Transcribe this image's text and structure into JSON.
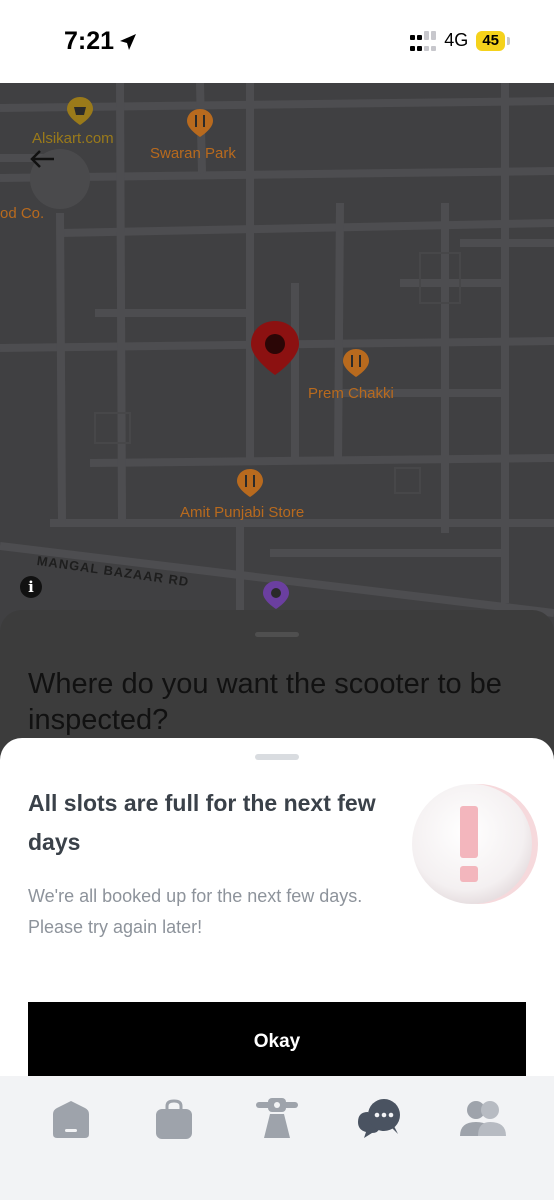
{
  "status_bar": {
    "time": "7:21",
    "network": "4G",
    "battery": "45"
  },
  "map": {
    "places": [
      {
        "name": "Alsikart.com"
      },
      {
        "name": "Swaran Park"
      },
      {
        "name": "od Co."
      },
      {
        "name": "Prem Chakki"
      },
      {
        "name": "Amit Punjabi Store"
      }
    ],
    "road_name": "MANGAL BAZAAR RD"
  },
  "background_sheet": {
    "title": "Where do you want the scooter to be inspected?"
  },
  "modal": {
    "title": "All slots are full for the next few days",
    "message": "We're all booked up for the next few days. Please try again later!",
    "button_label": "Okay"
  },
  "bottom_nav": {
    "items": [
      {
        "icon": "home-icon"
      },
      {
        "icon": "bag-icon"
      },
      {
        "icon": "scooter-icon"
      },
      {
        "icon": "chat-icon"
      },
      {
        "icon": "profile-icon"
      }
    ]
  },
  "colors": {
    "button_bg": "#000000",
    "poi_orange": "#b86a1e",
    "pin_red": "#8c1111",
    "battery_yellow": "#f5d21b"
  }
}
